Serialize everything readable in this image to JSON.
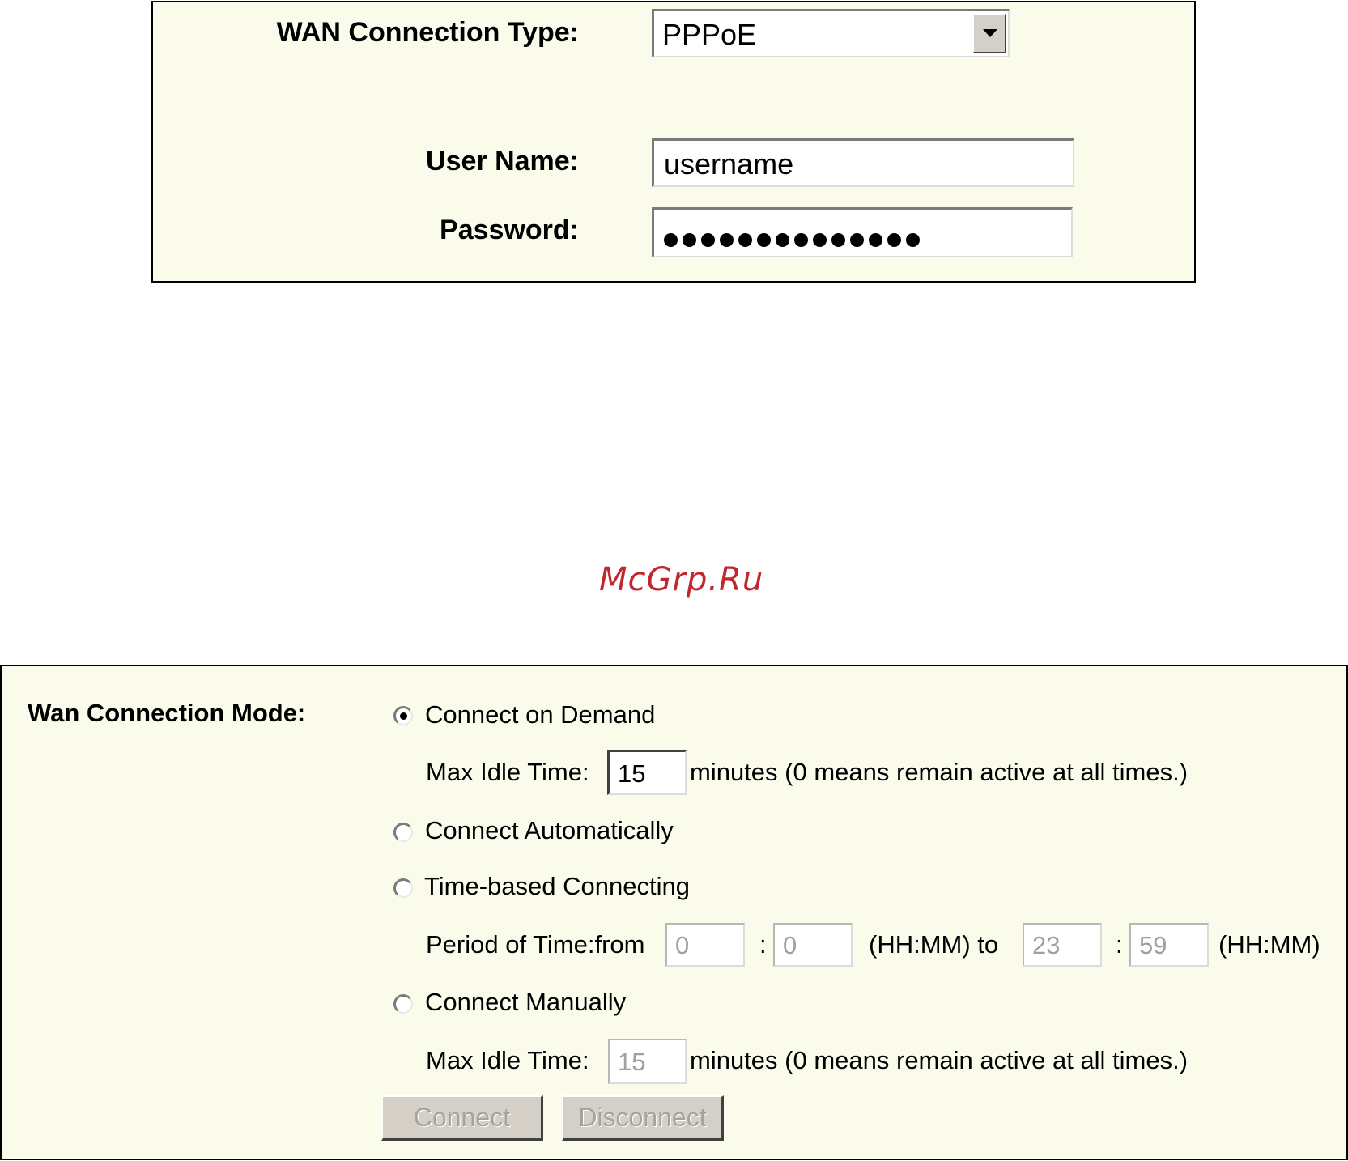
{
  "pppoe": {
    "wan_type_label": "WAN Connection Type:",
    "wan_type_value": "PPPoE",
    "username_label": "User Name:",
    "username_value": "username",
    "password_label": "Password:",
    "password_dot_count": 14
  },
  "watermark": "McGrp.Ru",
  "mode": {
    "label": "Wan Connection Mode:",
    "selected": "on_demand",
    "on_demand_label": "Connect on Demand",
    "max_idle_label_1": "Max Idle Time:",
    "max_idle_value_1": "15",
    "minutes_note_1": "minutes (0 means remain active at all times.)",
    "auto_label": "Connect Automatically",
    "time_based_label": "Time-based Connecting",
    "period_label": "Period of Time:from",
    "from_hh": "0",
    "colon_1": ":",
    "from_mm": "0",
    "hhmm_to": "(HH:MM) to",
    "to_hh": "23",
    "colon_2": ":",
    "to_mm": "59",
    "hhmm_end": "(HH:MM)",
    "manual_label": "Connect Manually",
    "max_idle_label_2": "Max Idle Time:",
    "max_idle_value_2": "15",
    "minutes_note_2": "minutes (0 means remain active at all times.)",
    "connect_button": "Connect",
    "disconnect_button": "Disconnect"
  }
}
